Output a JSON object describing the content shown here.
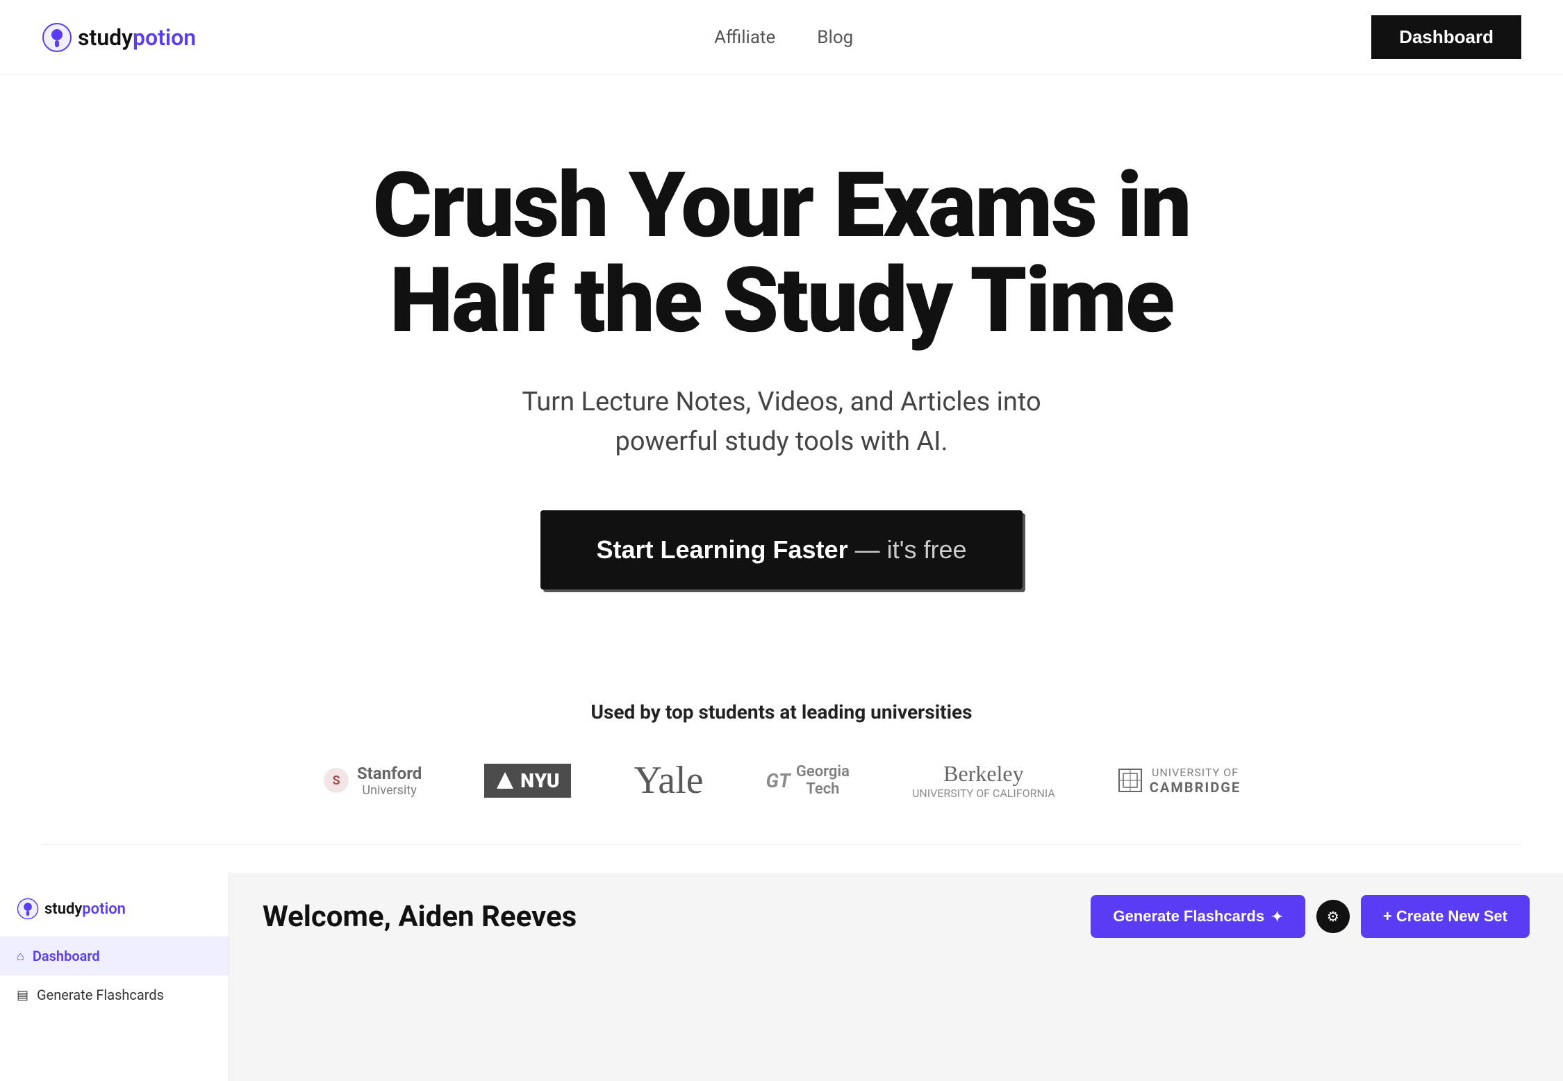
{
  "nav": {
    "logo_study": "study",
    "logo_potion": "potion",
    "links": [
      {
        "id": "affiliate",
        "label": "Affiliate"
      },
      {
        "id": "blog",
        "label": "Blog"
      }
    ],
    "dashboard_button": "Dashboard"
  },
  "hero": {
    "title": "Crush Your Exams in Half the Study Time",
    "subtitle": "Turn Lecture Notes, Videos, and Articles into powerful study tools with AI.",
    "cta_main": "Start Learning Faster",
    "cta_free": "— it's free"
  },
  "universities": {
    "label": "Used by top students at leading universities",
    "logos": [
      {
        "id": "stanford",
        "name": "Stanford University"
      },
      {
        "id": "nyu",
        "name": "NYU"
      },
      {
        "id": "yale",
        "name": "Yale"
      },
      {
        "id": "georgia-tech",
        "name": "Georgia Tech"
      },
      {
        "id": "berkeley",
        "name": "Berkeley"
      },
      {
        "id": "cambridge",
        "name": "University of Cambridge"
      }
    ]
  },
  "dashboard": {
    "sidebar": {
      "logo_study": "study",
      "logo_potion": "potion",
      "items": [
        {
          "id": "dashboard",
          "label": "Dashboard",
          "icon": "⌂",
          "active": true
        },
        {
          "id": "generate-flashcards",
          "label": "Generate Flashcards",
          "icon": "▤",
          "active": false
        }
      ]
    },
    "welcome": "Welcome, Aiden Reeves",
    "generate_button": "Generate Flashcards",
    "create_button": "+ Create New Set"
  }
}
